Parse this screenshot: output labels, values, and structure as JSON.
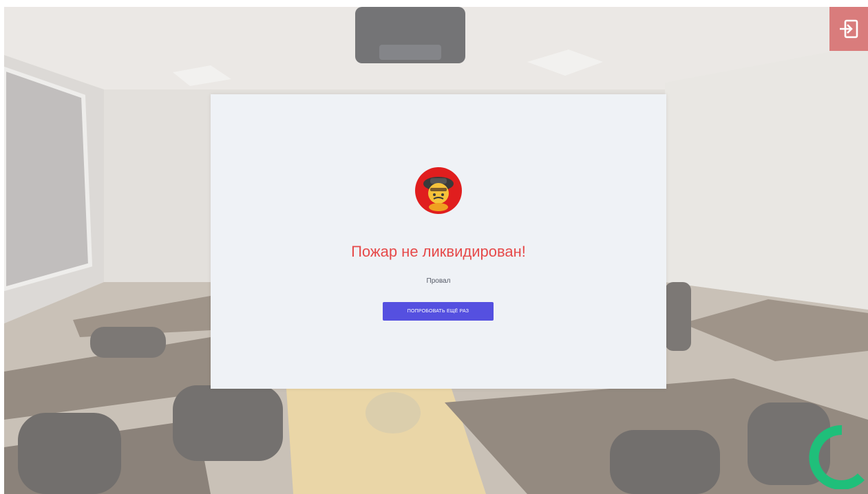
{
  "dialog": {
    "title": "Пожар не ликвидирован!",
    "subtitle": "Провал",
    "retry_label": "ПОПРОБОВАТЬ ЕЩЁ РАЗ"
  },
  "icons": {
    "exit": "exit-icon",
    "mascot": "firefighter-mascot-icon",
    "loading": "loading-spinner-icon"
  },
  "colors": {
    "exit_button": "#d97c7c",
    "title": "#e64a4a",
    "retry_button": "#5550e0",
    "spinner": "#1fbf7a",
    "modal_background": "#eff2f6"
  }
}
